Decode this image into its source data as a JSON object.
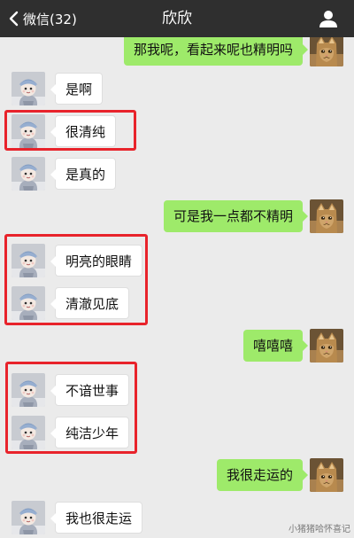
{
  "header": {
    "back_label": "微信(32)",
    "title": "欣欣"
  },
  "colors": {
    "header_bg": "#2f2f2f",
    "chat_bg": "#ebebeb",
    "sent_bubble": "#9eea6a",
    "received_bubble": "#ffffff",
    "highlight_box": "#e8232b"
  },
  "messages": [
    {
      "side": "right",
      "text": "那我呢，看起来呢也精明吗"
    },
    {
      "side": "left",
      "text": "是啊"
    },
    {
      "side": "left",
      "text": "很清纯"
    },
    {
      "side": "left",
      "text": "是真的"
    },
    {
      "side": "right",
      "text": "可是我一点都不精明"
    },
    {
      "side": "left",
      "text": "明亮的眼睛"
    },
    {
      "side": "left",
      "text": "清澈见底"
    },
    {
      "side": "right",
      "text": "嘻嘻嘻"
    },
    {
      "side": "left",
      "text": "不谙世事"
    },
    {
      "side": "left",
      "text": "纯洁少年"
    },
    {
      "side": "right",
      "text": "我很走运的"
    },
    {
      "side": "left",
      "text": "我也很走运"
    }
  ],
  "watermark": "小猪猪哈怀喜记"
}
